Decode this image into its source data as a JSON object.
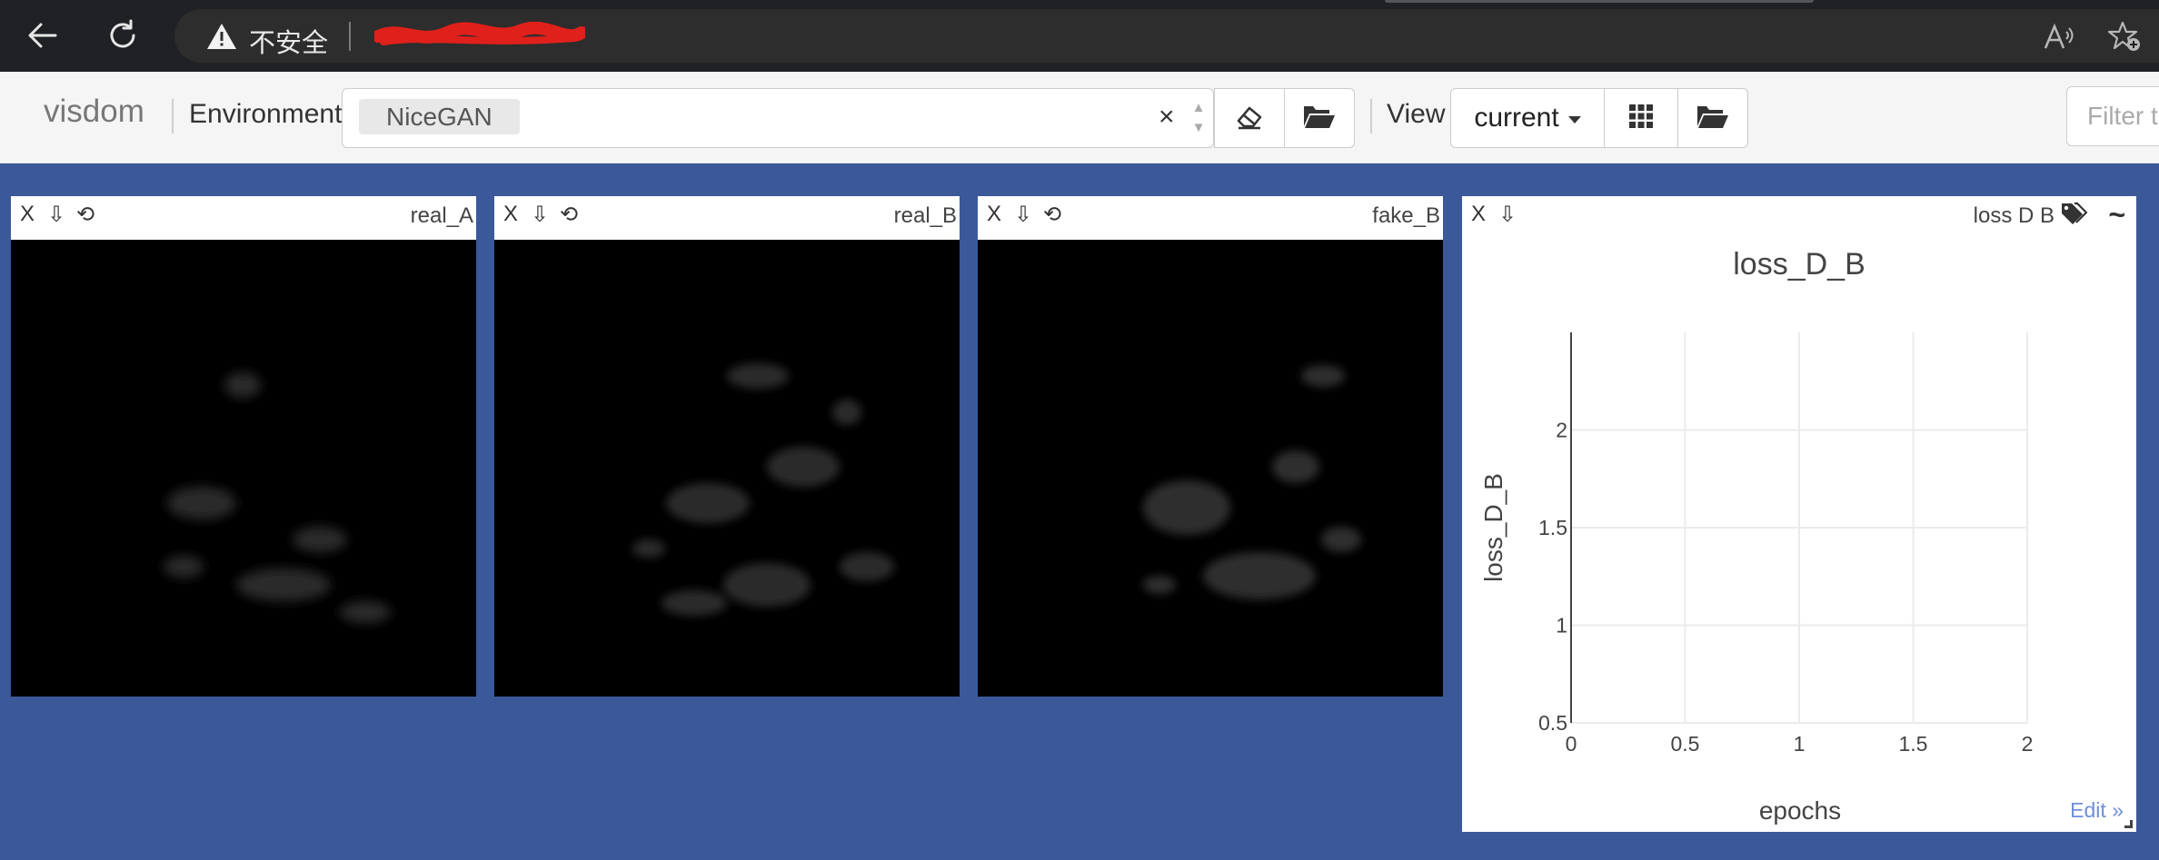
{
  "browser": {
    "security_label": "不安全",
    "icons": {
      "back": "back-arrow-icon",
      "reload": "reload-icon",
      "warning": "warning-triangle-icon",
      "read_aloud": "read-aloud-icon",
      "favorites": "favorites-add-icon"
    }
  },
  "toolbar": {
    "brand": "visdom",
    "environment_label": "Environment",
    "environment_tag": "NiceGAN",
    "clear_symbol": "×",
    "view_label": "View",
    "view_selected": "current",
    "filter_placeholder": "Filter text"
  },
  "panes": [
    {
      "title": "real_A",
      "close": "X",
      "download": "⇩",
      "reset": "⟲"
    },
    {
      "title": "real_B",
      "close": "X",
      "download": "⇩",
      "reset": "⟲"
    },
    {
      "title": "fake_B",
      "close": "X",
      "download": "⇩",
      "reset": "⟲"
    }
  ],
  "plot_pane": {
    "title": "loss_D_B",
    "close": "X",
    "download": "⇩",
    "smooth_symbol": "~",
    "edit_label": "Edit »"
  },
  "chart_data": {
    "type": "line",
    "title": "loss_D_B",
    "xlabel": "epochs",
    "ylabel": "loss_D_B",
    "xlim": [
      0,
      2
    ],
    "ylim": [
      0.5,
      2.5
    ],
    "x_ticks": [
      "0",
      "0.5",
      "1",
      "1.5",
      "2"
    ],
    "y_ticks": [
      "0.5",
      "1",
      "1.5",
      "2"
    ],
    "grid": true,
    "series": []
  },
  "colors": {
    "page_background": "#3b5998",
    "chrome_background": "#202124",
    "toolbar_background": "#f5f5f5"
  }
}
